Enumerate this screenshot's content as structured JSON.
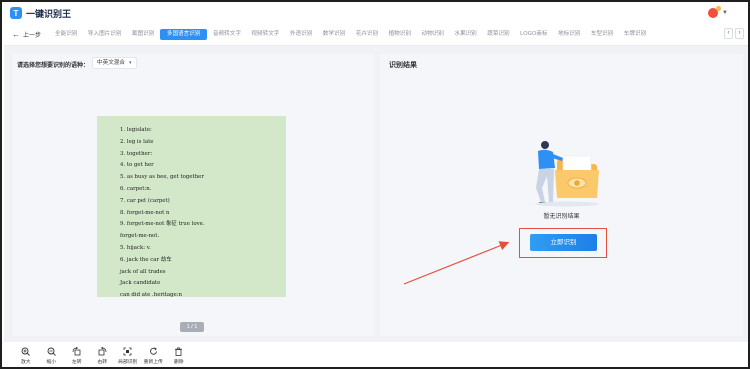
{
  "app": {
    "title": "一键识别王",
    "logo_glyph": "T",
    "accent_color": "#2e8ff5"
  },
  "nav": {
    "back_label": "上一步",
    "tabs": [
      {
        "label": "全能识别",
        "active": false
      },
      {
        "label": "导入图片识别",
        "active": false
      },
      {
        "label": "截图识别",
        "active": false
      },
      {
        "label": "多国语言识别",
        "active": true
      },
      {
        "label": "音频转文字",
        "active": false
      },
      {
        "label": "视频转文字",
        "active": false
      },
      {
        "label": "外语识别",
        "active": false
      },
      {
        "label": "数学识别",
        "active": false
      },
      {
        "label": "花卉识别",
        "active": false
      },
      {
        "label": "植物识别",
        "active": false
      },
      {
        "label": "动物识别",
        "active": false
      },
      {
        "label": "水果识别",
        "active": false
      },
      {
        "label": "蔬菜识别",
        "active": false
      },
      {
        "label": "LOGO商标",
        "active": false
      },
      {
        "label": "地标识别",
        "active": false
      },
      {
        "label": "车型识别",
        "active": false
      },
      {
        "label": "车牌识别",
        "active": false
      }
    ]
  },
  "source": {
    "language_label": "请选择您想要识别的语种：",
    "language_value": "中英文混合",
    "page_indicator": "1 / 1",
    "preview_lines": [
      "1. legislate:",
      "2. leg is late",
      "3. together:",
      "4. to get her",
      "5. as busy as bee, get together",
      "6. carpet:n.",
      "7. car pet (carpet)",
      "8. forget-me-not n",
      "9. forget-me-not 象征 true love.",
      "forget-me-not.",
      "5. hijack: v.",
      "6. jack the car 劫车",
      "jack of all trades",
      "Jack   candidate",
      "can did ate .heritage:n"
    ]
  },
  "result": {
    "title": "识别结果",
    "empty_text": "暂无识别结果",
    "recognize_button": "立即识别",
    "highlight_color": "#e3503f"
  },
  "toolbar": [
    {
      "label": "放大",
      "icon": "zoom-in-icon"
    },
    {
      "label": "缩小",
      "icon": "zoom-out-icon"
    },
    {
      "label": "左转",
      "icon": "rotate-left-icon"
    },
    {
      "label": "右转",
      "icon": "rotate-right-icon"
    },
    {
      "label": "局部识别",
      "icon": "crop-icon"
    },
    {
      "label": "重新上传",
      "icon": "reupload-icon"
    },
    {
      "label": "删除",
      "icon": "trash-icon"
    }
  ]
}
